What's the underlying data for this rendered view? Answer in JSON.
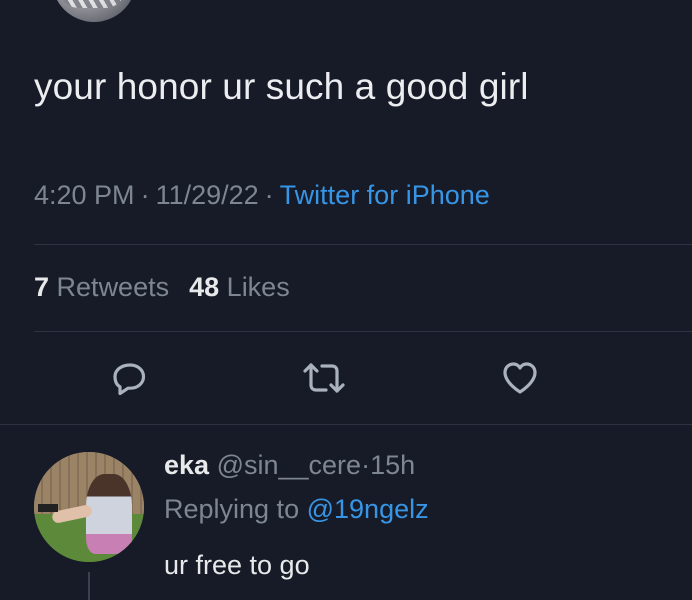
{
  "tweet": {
    "text": "your honor ur such a good girl",
    "time": "4:20 PM",
    "date": "11/29/22",
    "separator": "·",
    "source": "Twitter for iPhone"
  },
  "stats": {
    "retweets_count": "7",
    "retweets_label": "Retweets",
    "likes_count": "48",
    "likes_label": "Likes"
  },
  "actions": {
    "icons": [
      "reply-icon",
      "retweet-icon",
      "like-icon"
    ]
  },
  "reply": {
    "name": "eka",
    "handle": "@sin__cere",
    "separator": "·",
    "age": "15h",
    "replying_prefix": "Replying to",
    "replying_to": "@19ngelz",
    "text": "ur free to go"
  },
  "colors": {
    "background": "#171b27",
    "link": "#3795e6",
    "secondary_text": "#7d8691",
    "primary_text": "#e7e9ea"
  }
}
